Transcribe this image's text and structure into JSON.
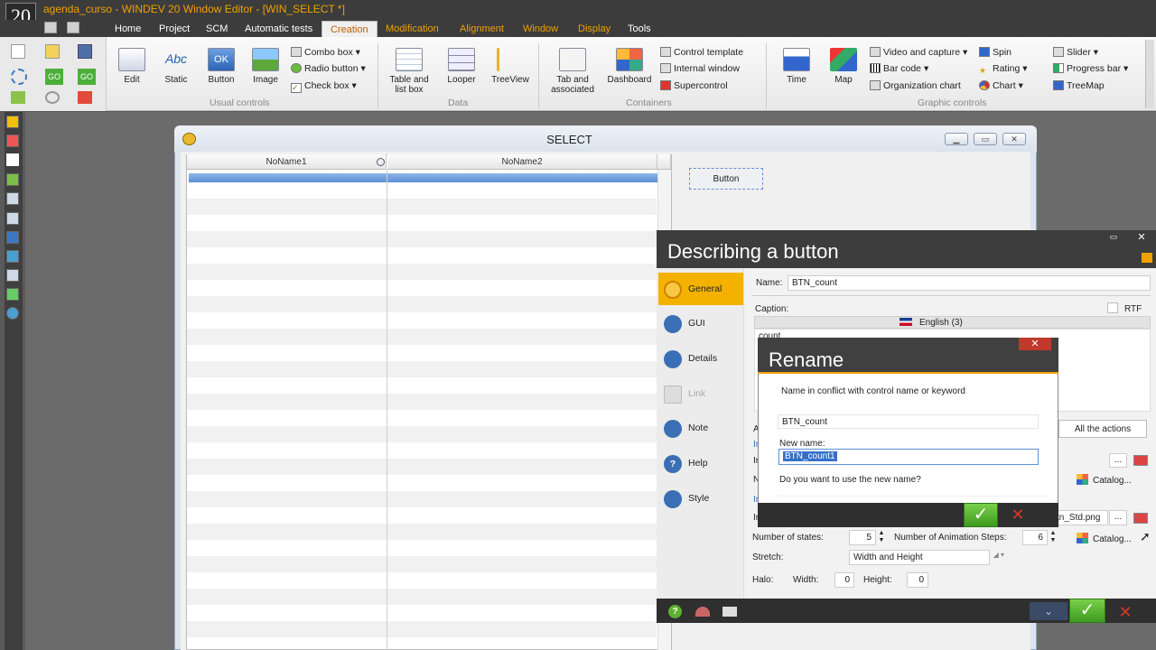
{
  "app": {
    "logo": "20",
    "title": "agenda_curso - WINDEV 20  Window Editor - [WIN_SELECT *]"
  },
  "menu": [
    "Home",
    "Project",
    "SCM",
    "Automatic tests",
    "Creation",
    "Modification",
    "Alignment",
    "Window",
    "Display",
    "Tools"
  ],
  "ribbon": {
    "usual_controls": {
      "label": "Usual controls",
      "big": [
        "Edit",
        "Static",
        "Button",
        "Image"
      ],
      "static_icon": "Abc",
      "button_icon": "OK",
      "small": [
        "Combo box",
        "Radio button",
        "Check box"
      ]
    },
    "data": {
      "label": "Data",
      "big": [
        "Table and list box",
        "Looper",
        "TreeView"
      ]
    },
    "containers": {
      "label": "Containers",
      "big": [
        "Tab and associated",
        "Dashboard"
      ],
      "small": [
        "Control template",
        "Internal window",
        "Supercontrol"
      ]
    },
    "graphic": {
      "label": "Graphic controls",
      "big": [
        "Time",
        "Map"
      ],
      "small": [
        "Video and capture",
        "Bar code",
        "Organization chart",
        "Spin",
        "Rating",
        "Chart",
        "Slider",
        "Progress bar",
        "TreeMap"
      ]
    }
  },
  "window": {
    "caption": "SELECT",
    "columns": [
      "NoName1",
      "NoName2"
    ],
    "button_label": "Button"
  },
  "describe": {
    "title": "Describing a button",
    "tabs": [
      "General",
      "GUI",
      "Details",
      "Link",
      "Note",
      "Help",
      "Style"
    ],
    "name_label": "Name:",
    "name_value": "BTN_count",
    "caption_label": "Caption:",
    "rtf_label": "RTF",
    "language": "English (3)",
    "caption_value": "count",
    "all_actions": "All the actions",
    "image_value": "tn_Std.png",
    "catalog": "Catalog...",
    "states_label": "Number of states:",
    "states_value": "5",
    "anim_label": "Number of Animation Steps:",
    "anim_value": "6",
    "stretch_label": "Stretch:",
    "stretch_value": "Width and Height",
    "halo_label": "Halo:",
    "width_label": "Width:",
    "width_value": "0",
    "height_label": "Height:",
    "height_value": "0",
    "side_letters": [
      "A",
      "In",
      "In",
      "N",
      "In",
      "In"
    ]
  },
  "rename": {
    "title": "Rename",
    "message": "Name in conflict with control name or keyword",
    "old_name": "BTN_count",
    "new_label": "New name:",
    "new_value": "BTN_count1",
    "question": "Do you want to use the new name?"
  }
}
